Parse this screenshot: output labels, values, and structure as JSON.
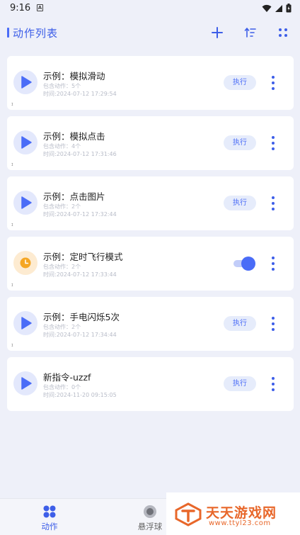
{
  "status_bar": {
    "time": "9:16",
    "notification_letter": "A",
    "icons": [
      "wifi-icon",
      "signal-icon",
      "battery-icon"
    ]
  },
  "header": {
    "title": "动作列表",
    "icons": [
      "add-icon",
      "sort-icon",
      "grid-icon"
    ]
  },
  "actions": [
    {
      "title": "示例：模拟滑动",
      "count": "包含动作：5个",
      "time": "时间:2024-07-12 17:29:54",
      "icon": "play-icon",
      "control": "button",
      "tick": "ɪ"
    },
    {
      "title": "示例：模拟点击",
      "count": "包含动作：4个",
      "time": "时间:2024-07-12 17:31:46",
      "icon": "play-icon",
      "control": "button",
      "tick": "ɪ"
    },
    {
      "title": "示例：点击图片",
      "count": "包含动作：2个",
      "time": "时间:2024-07-12 17:32:44",
      "icon": "play-icon",
      "control": "button",
      "tick": "ɪ"
    },
    {
      "title": "示例：定时飞行模式",
      "count": "包含动作：2个",
      "time": "时间:2024-07-12 17:33:44",
      "icon": "clock-icon",
      "control": "toggle",
      "toggle_on": true,
      "tick": "ɪ"
    },
    {
      "title": "示例：手电闪烁5次",
      "count": "包含动作：2个",
      "time": "时间:2024-07-12 17:34:44",
      "icon": "play-icon",
      "control": "button",
      "tick": "ɪ"
    },
    {
      "title": "新指令-uzzf",
      "count": "包含动作：0个",
      "time": "时间:2024-11-20 09:15:05",
      "icon": "play-icon",
      "control": "button",
      "tick": ""
    }
  ],
  "exec_label": "执行",
  "bottom_nav": {
    "items": [
      {
        "label": "动作",
        "icon": "grid-apps-icon",
        "active": true
      },
      {
        "label": "悬浮球",
        "icon": "floating-ball-icon",
        "active": false
      }
    ]
  },
  "watermark": {
    "name": "天天游戏网",
    "url": "www.ttyl23.com"
  },
  "colors": {
    "accent": "#4a6cf7",
    "background": "#eef0f9",
    "card": "#ffffff",
    "watermark": "#e8672a"
  }
}
